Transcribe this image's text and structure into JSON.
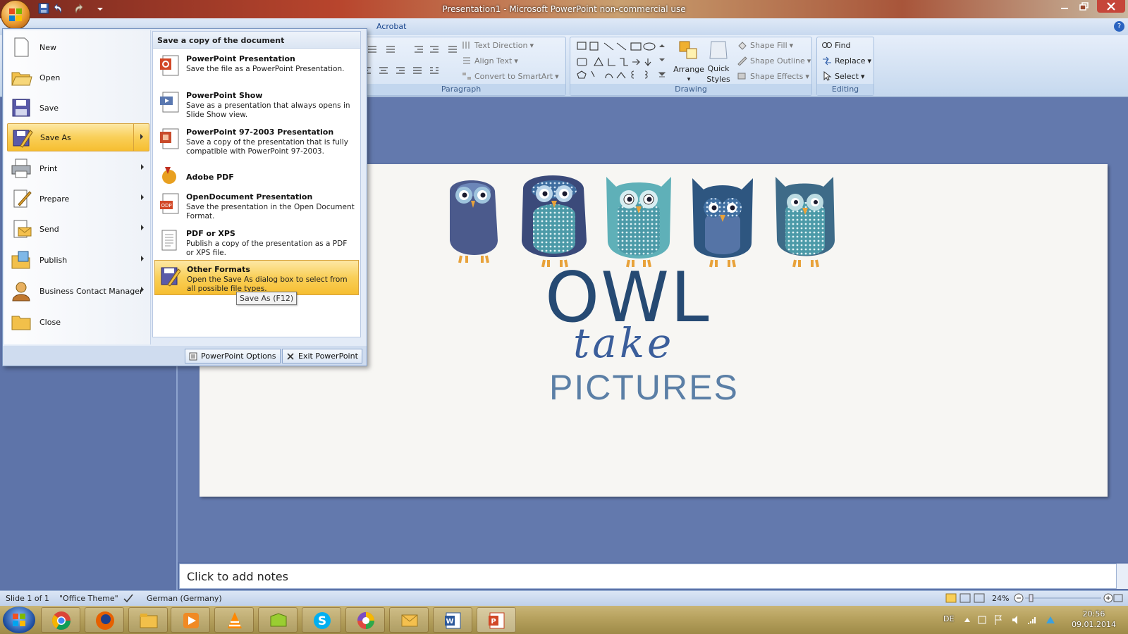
{
  "window": {
    "title": "Presentation1 - Microsoft PowerPoint non-commercial use"
  },
  "ribbon": {
    "visible_tab": "Acrobat",
    "paragraph": {
      "label": "Paragraph",
      "text_direction": "Text Direction",
      "align_text": "Align Text",
      "convert_smartart": "Convert to SmartArt"
    },
    "drawing": {
      "label": "Drawing",
      "arrange": "Arrange",
      "quick_styles_1": "Quick",
      "quick_styles_2": "Styles",
      "shape_fill": "Shape Fill",
      "shape_outline": "Shape Outline",
      "shape_effects": "Shape Effects"
    },
    "editing": {
      "label": "Editing",
      "find": "Find",
      "replace": "Replace",
      "select": "Select"
    }
  },
  "office_menu": {
    "items": [
      {
        "label": "New",
        "icon": "new-document-icon"
      },
      {
        "label": "Open",
        "icon": "open-folder-icon"
      },
      {
        "label": "Save",
        "icon": "save-disk-icon"
      },
      {
        "label": "Save As",
        "icon": "save-as-icon",
        "selected": true,
        "submenu": true
      },
      {
        "label": "Print",
        "icon": "printer-icon",
        "submenu": true
      },
      {
        "label": "Prepare",
        "icon": "prepare-icon",
        "submenu": true
      },
      {
        "label": "Send",
        "icon": "send-icon",
        "submenu": true
      },
      {
        "label": "Publish",
        "icon": "publish-icon",
        "submenu": true
      },
      {
        "label": "Business Contact Manager",
        "icon": "contact-manager-icon",
        "submenu": true
      },
      {
        "label": "Close",
        "icon": "close-folder-icon"
      }
    ],
    "submenu_header": "Save a copy of the document",
    "submenu": [
      {
        "title": "PowerPoint Presentation",
        "desc": "Save the file as a PowerPoint Presentation."
      },
      {
        "title": "PowerPoint Show",
        "desc": "Save as a presentation that always opens in Slide Show view."
      },
      {
        "title": "PowerPoint 97-2003 Presentation",
        "desc": "Save a copy of the presentation that is fully compatible with PowerPoint 97-2003."
      },
      {
        "title": "Adobe PDF",
        "desc": ""
      },
      {
        "title": "OpenDocument Presentation",
        "desc": "Save the presentation in the Open Document Format."
      },
      {
        "title": "PDF or XPS",
        "desc": "Publish a copy of the presentation as a PDF or XPS file."
      },
      {
        "title": "Other Formats",
        "desc": "Open the Save As dialog box to select from all possible file types.",
        "selected": true
      }
    ],
    "tooltip": "Save As (F12)",
    "options_button": "PowerPoint Options",
    "exit_button": "Exit PowerPoint"
  },
  "slide": {
    "line1": "OWL",
    "line2": "take",
    "line3": "PICTURES"
  },
  "notes": {
    "placeholder": "Click to add notes"
  },
  "status": {
    "slide": "Slide 1 of 1",
    "theme": "\"Office Theme\"",
    "language": "German (Germany)",
    "zoom": "24%"
  },
  "taskbar": {
    "lang": "DE",
    "time": "20:56",
    "date": "09.01.2014"
  },
  "colors": {
    "accent": "#f9cf58",
    "owl_text": "#264a73",
    "pictures_text": "#5b7fa6"
  }
}
